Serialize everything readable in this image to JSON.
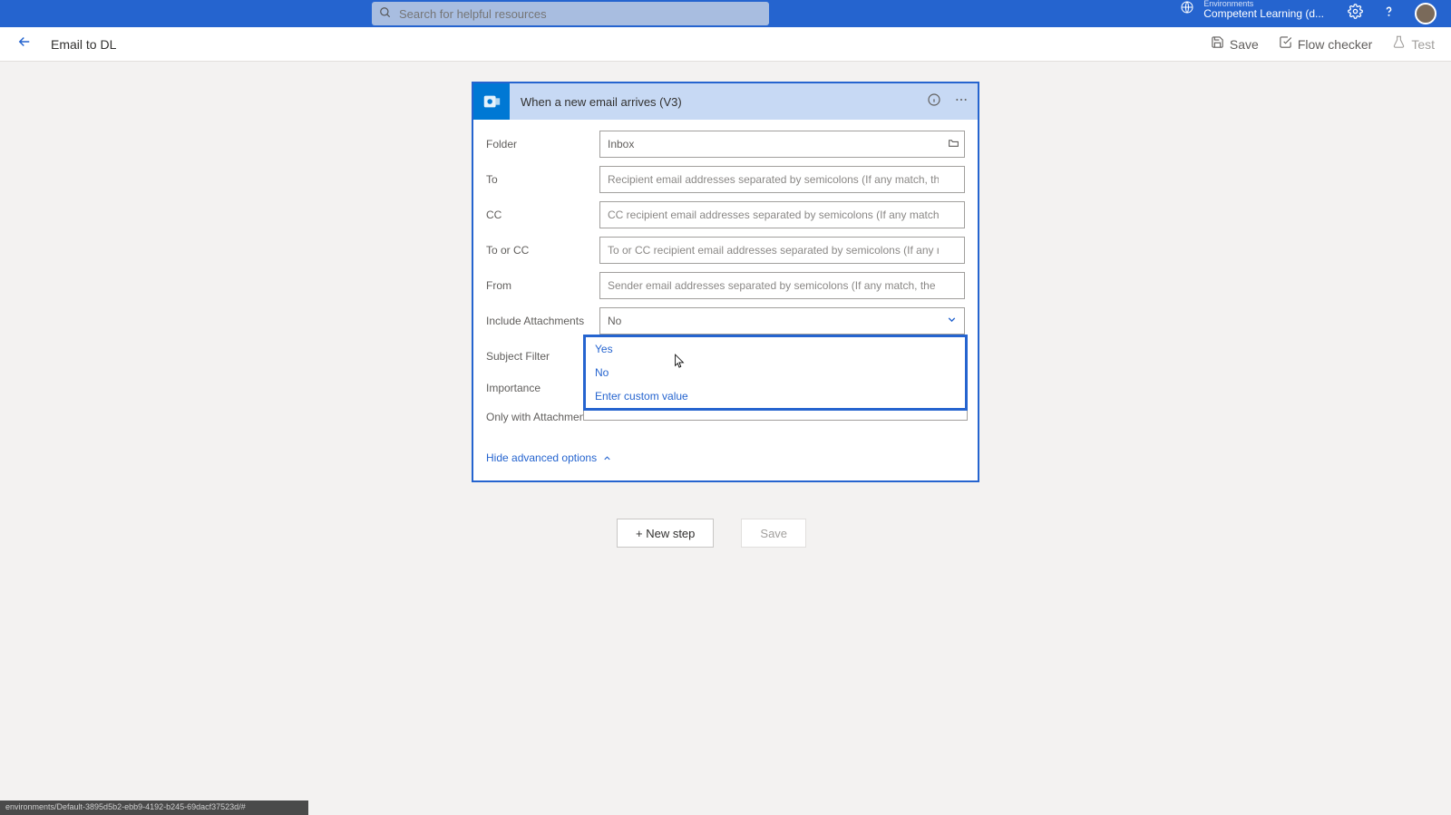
{
  "header": {
    "search_placeholder": "Search for helpful resources",
    "env_label": "Environments",
    "env_value": "Competent Learning (d..."
  },
  "subheader": {
    "title": "Email to DL",
    "save": "Save",
    "flow_checker": "Flow checker",
    "test": "Test"
  },
  "card": {
    "title": "When a new email arrives (V3)",
    "fields": {
      "folder": {
        "label": "Folder",
        "value": "Inbox"
      },
      "to": {
        "label": "To",
        "placeholder": "Recipient email addresses separated by semicolons (If any match, the"
      },
      "cc": {
        "label": "CC",
        "placeholder": "CC recipient email addresses separated by semicolons (If any match,"
      },
      "toorcc": {
        "label": "To or CC",
        "placeholder": "To or CC recipient email addresses separated by semicolons (If any m"
      },
      "from": {
        "label": "From",
        "placeholder": "Sender email addresses separated by semicolons (If any match, the t"
      },
      "include_attachments": {
        "label": "Include Attachments",
        "value": "No"
      },
      "subject_filter": {
        "label": "Subject Filter"
      },
      "importance": {
        "label": "Importance"
      },
      "only_attachments": {
        "label": "Only with Attachments"
      }
    },
    "hide_advanced": "Hide advanced options"
  },
  "dropdown": {
    "options": [
      "Yes",
      "No",
      "Enter custom value"
    ]
  },
  "buttons": {
    "new_step": "+ New step",
    "save": "Save"
  },
  "status_bar": "environments/Default-3895d5b2-ebb9-4192-b245-69dacf37523d/#"
}
